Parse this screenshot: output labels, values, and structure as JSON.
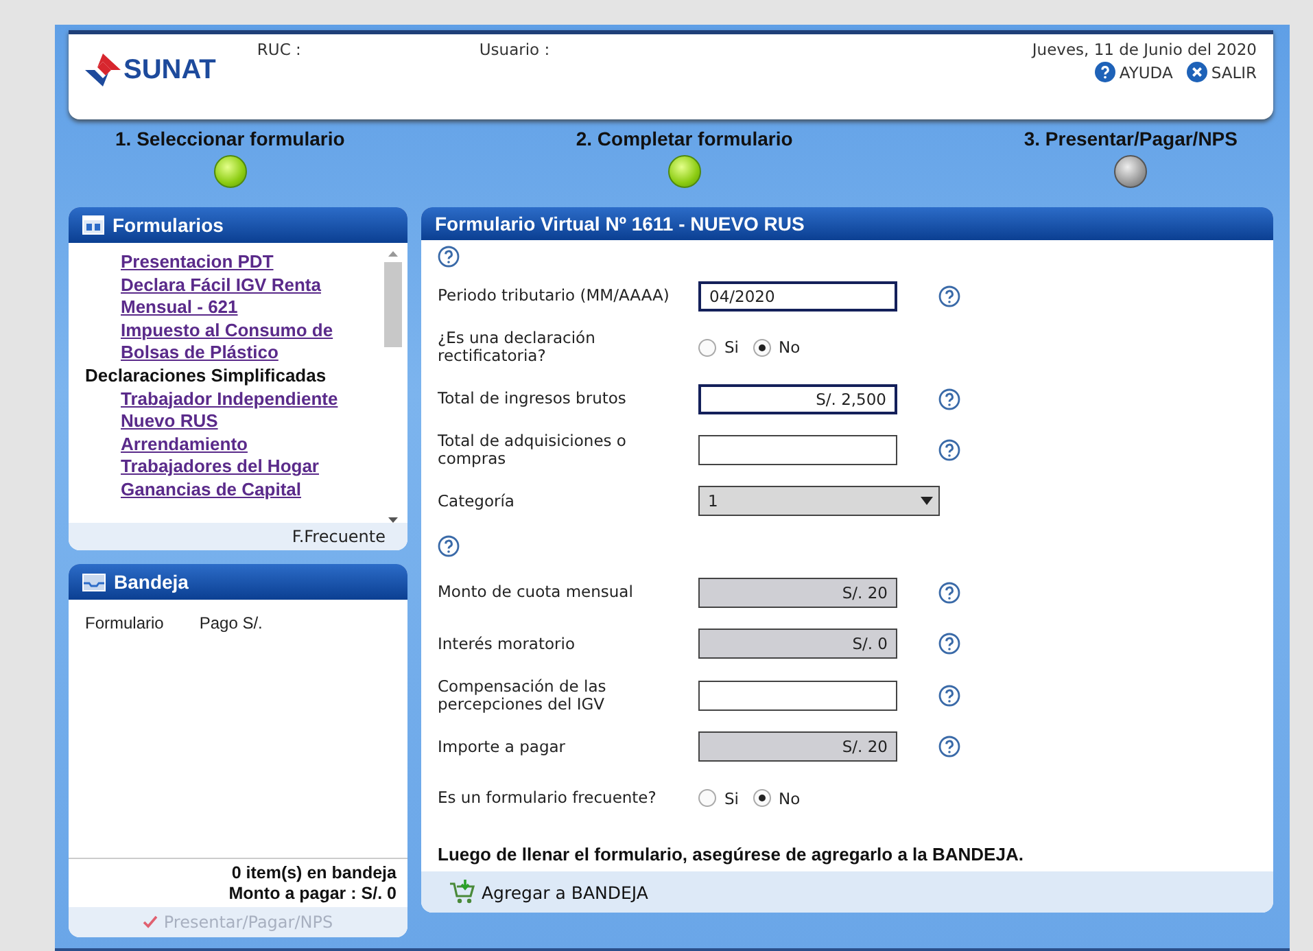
{
  "header": {
    "logo": "SUNAT",
    "ruc_label": "RUC :",
    "usuario_label": "Usuario :",
    "date": "Jueves, 11 de Junio del 2020",
    "links": [
      {
        "kind": "help",
        "label": "AYUDA"
      },
      {
        "kind": "exit",
        "label": "SALIR"
      }
    ]
  },
  "steps": [
    {
      "label": "1. Seleccionar formulario",
      "done": true
    },
    {
      "label": "2. Completar formulario",
      "done": true
    },
    {
      "label": "3. Presentar/Pagar/NPS",
      "done": false
    }
  ],
  "formularios": {
    "title": "Formularios",
    "items": [
      {
        "kind": "link",
        "label": "Presentacion PDT"
      },
      {
        "kind": "link",
        "label": "Declara Fácil IGV Renta"
      },
      {
        "kind": "link",
        "label": "Mensual - 621"
      },
      {
        "kind": "link",
        "label": "Impuesto al Consumo de"
      },
      {
        "kind": "link",
        "label": "Bolsas de Plástico"
      },
      {
        "kind": "heading",
        "label": "Declaraciones Simplificadas"
      },
      {
        "kind": "link",
        "label": "Trabajador Independiente"
      },
      {
        "kind": "link",
        "label": "Nuevo RUS"
      },
      {
        "kind": "link",
        "label": "Arrendamiento"
      },
      {
        "kind": "link",
        "label": "Trabajadores del Hogar"
      },
      {
        "kind": "link",
        "label": "Ganancias de Capital"
      }
    ],
    "footer": "F.Frecuente"
  },
  "bandeja": {
    "title": "Bandeja",
    "columns": [
      "Formulario",
      "Pago S/."
    ],
    "count": "0 item(s) en bandeja",
    "total": "Monto a pagar : S/. 0",
    "button": {
      "label": "Presentar/Pagar/NPS",
      "disabled": true
    }
  },
  "form": {
    "title": "Formulario Virtual Nº 1611 - NUEVO RUS",
    "rows": [
      {
        "kind": "help"
      },
      {
        "kind": "text",
        "label": "Periodo tributario (MM/AAAA)",
        "value": "04/2020",
        "highlighted": true,
        "help": true
      },
      {
        "kind": "radio",
        "label": "¿Es una declaración rectificatoria?",
        "options": [
          {
            "label": "Si",
            "selected": false
          },
          {
            "label": "No",
            "selected": true
          }
        ]
      },
      {
        "kind": "amount",
        "label": "Total de ingresos brutos",
        "value": "S/. 2,500",
        "highlighted": true,
        "help": true
      },
      {
        "kind": "amount",
        "label": "Total de adquisiciones o compras",
        "highlighted": false,
        "help": true
      },
      {
        "kind": "select",
        "label": "Categoría",
        "value": "1"
      },
      {
        "kind": "help"
      },
      {
        "kind": "readonly",
        "label": "Monto de cuota mensual",
        "value": "S/. 20",
        "help": true
      },
      {
        "kind": "readonly",
        "label": "Interés moratorio",
        "value": "S/. 0",
        "help": true
      },
      {
        "kind": "amount",
        "label": "Compensación de las percepciones del IGV",
        "highlighted": false,
        "help": true
      },
      {
        "kind": "readonly",
        "label": "Importe a pagar",
        "value": "S/. 20",
        "help": true
      },
      {
        "kind": "radio",
        "label": "Es un formulario frecuente?",
        "options": [
          {
            "label": "Si",
            "selected": false
          },
          {
            "label": "No",
            "selected": true
          }
        ]
      }
    ],
    "note": "Luego de llenar el formulario, asegúrese de agregarlo a la BANDEJA.",
    "button": "Agregar a BANDEJA"
  }
}
